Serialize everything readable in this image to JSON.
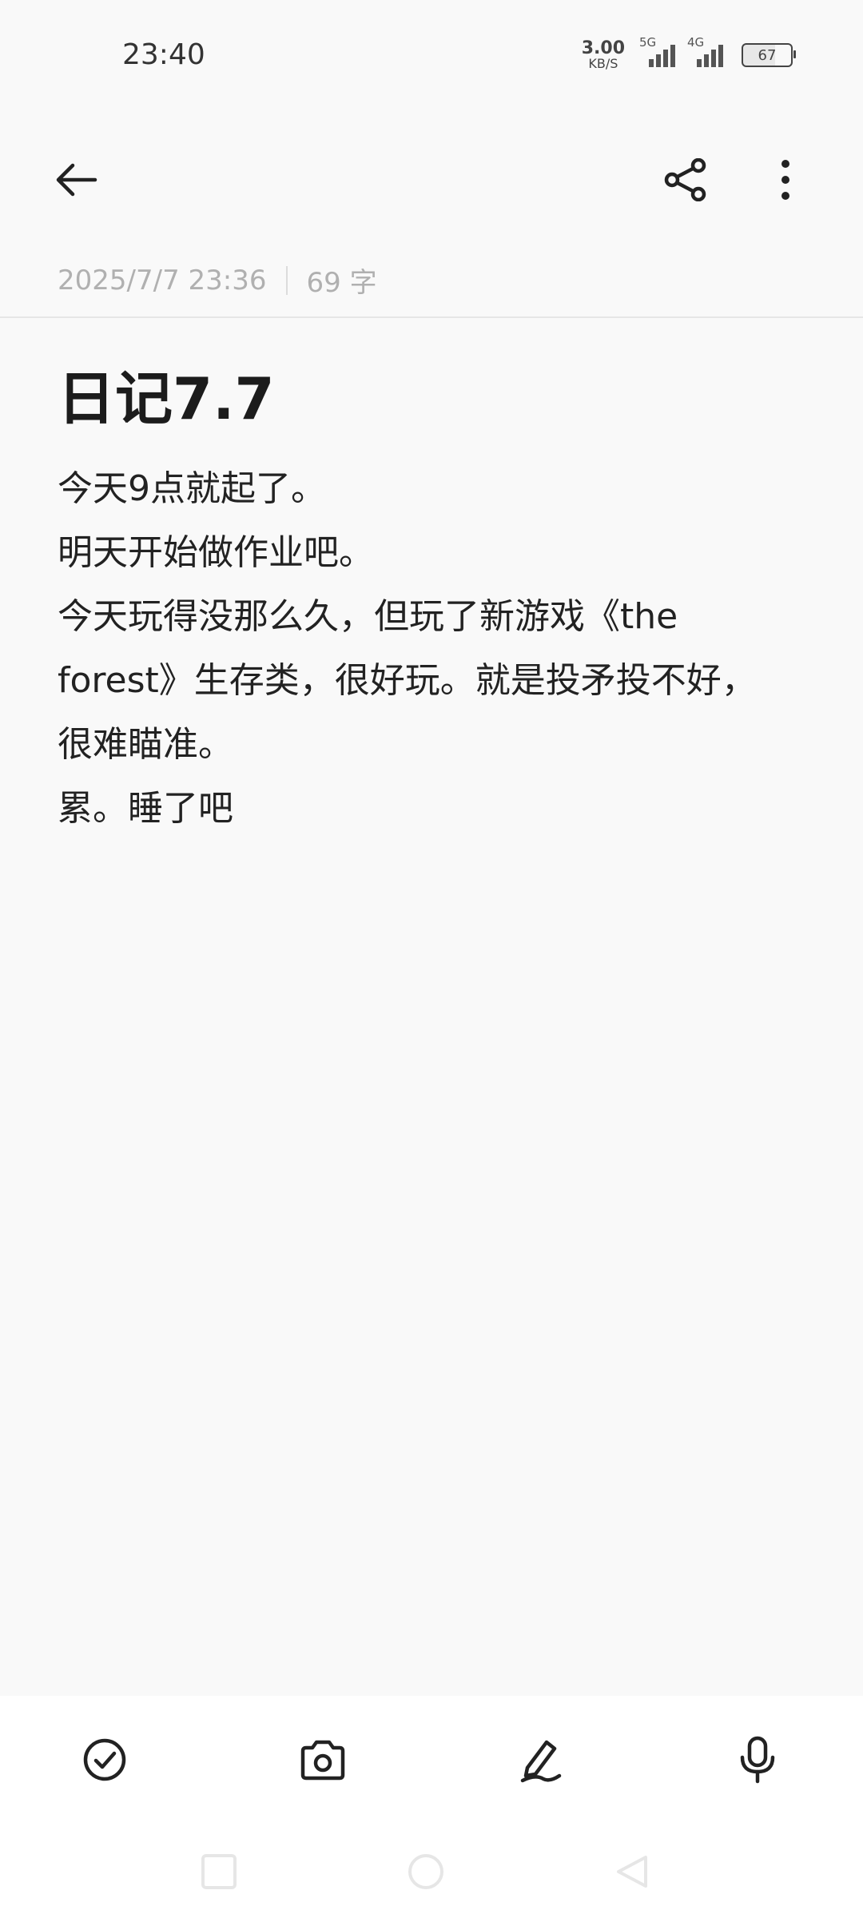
{
  "status_bar": {
    "time": "23:40",
    "net_speed_value": "3.00",
    "net_speed_unit": "KB/S",
    "signal_1_label": "5G",
    "signal_2_label": "4G",
    "battery_level": "67"
  },
  "app_bar": {
    "back_icon": "arrow-left-icon",
    "share_icon": "share-icon",
    "more_icon": "more-vertical-icon"
  },
  "meta": {
    "datetime": "2025/7/7 23:36",
    "word_count": "69 字"
  },
  "note": {
    "title": "日记7.7",
    "lines": [
      "今天9点就起了。",
      "明天开始做作业吧。",
      "今天玩得没那么久，但玩了新游戏《the forest》生存类，很好玩。就是投矛投不好，很难瞄准。",
      "累。睡了吧"
    ]
  },
  "toolbar": {
    "icons": [
      "checkbox-icon",
      "camera-icon",
      "pen-icon",
      "microphone-icon"
    ]
  },
  "nav": {
    "icons": [
      "recent-apps-icon",
      "home-icon",
      "back-triangle-icon"
    ]
  },
  "colors": {
    "background": "#f9f9f9",
    "text": "#1f1f1f",
    "meta_text": "#b0b0b0",
    "toolbar_bg": "#ffffff"
  }
}
